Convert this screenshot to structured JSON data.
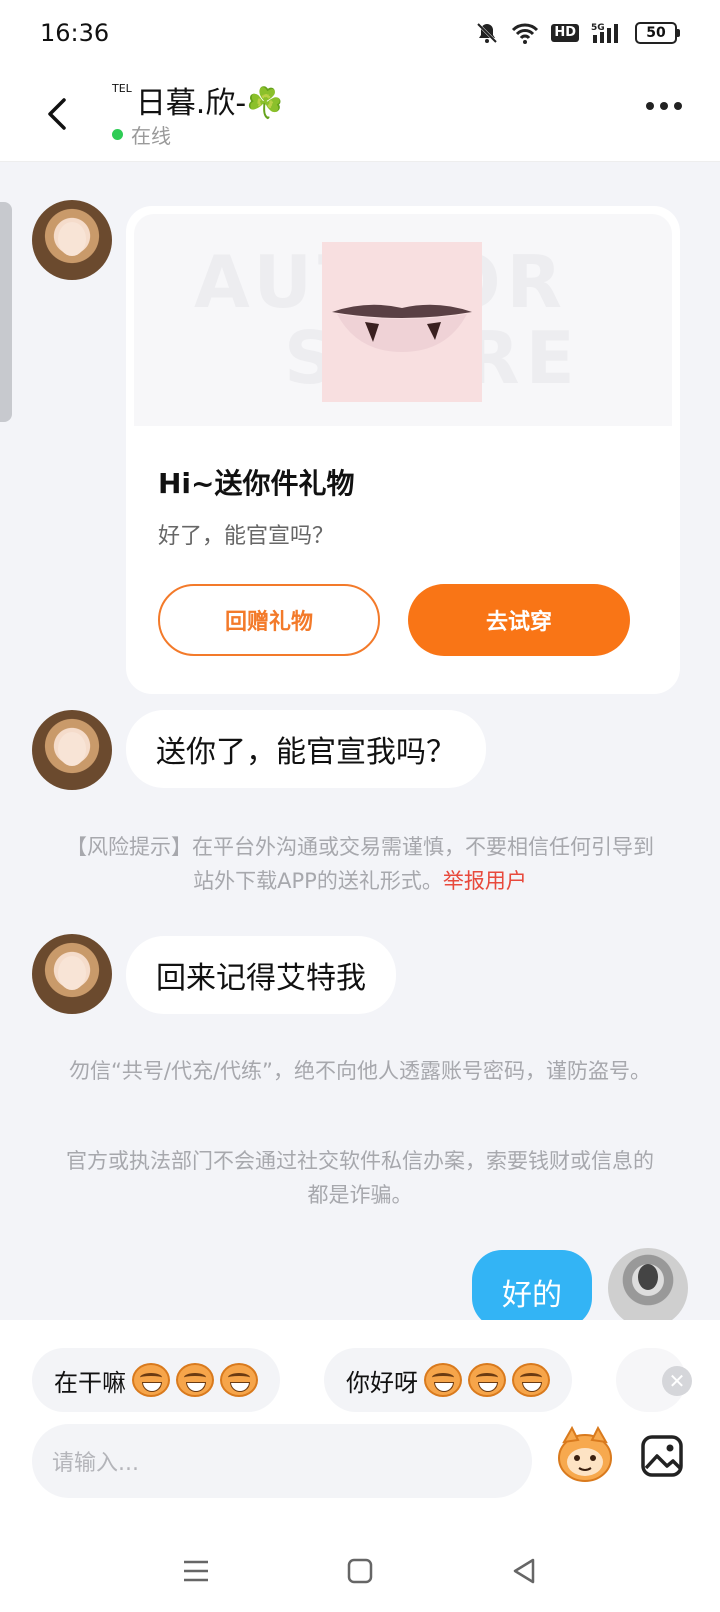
{
  "status_bar": {
    "time": "16:36",
    "battery": "50",
    "network": "5G",
    "hd": "HD"
  },
  "header": {
    "tel_label": "TEL",
    "contact_name": "日暮.欣-☘️",
    "status": "在线"
  },
  "gift_card": {
    "watermark_line1": "AUTHOR",
    "watermark_line2": "STORE",
    "title": "Hi~送你件礼物",
    "subtitle": "好了，能官宣吗？",
    "btn_return": "回赠礼物",
    "btn_try": "去试穿"
  },
  "messages": {
    "msg1": "送你了，能官宣我吗？",
    "msg2": "回来记得艾特我",
    "self_msg": "好的"
  },
  "notices": {
    "risk": "【风险提示】在平台外沟通或交易需谨慎，不要相信任何引导到站外下载APP的送礼形式。",
    "report": "举报用户",
    "account": "勿信“共号/代充/代练”，绝不向他人透露账号密码，谨防盗号。",
    "official": "官方或执法部门不会通过社交软件私信办案，索要钱财或信息的都是诈骗。"
  },
  "quick_replies": [
    {
      "label": "在干嘛"
    },
    {
      "label": "你好呀"
    }
  ],
  "input": {
    "placeholder": "请输入..."
  },
  "colors": {
    "accent": "#f97516",
    "self_bubble": "#33b4f5",
    "online": "#2ecc55",
    "report": "#e8493c"
  },
  "icons": [
    "mute-bell-icon",
    "wifi-icon",
    "signal-icon",
    "back-arrow-icon",
    "more-icon",
    "emoji-sticker-icon",
    "image-icon",
    "menu-nav-icon",
    "home-nav-icon",
    "back-nav-icon"
  ]
}
